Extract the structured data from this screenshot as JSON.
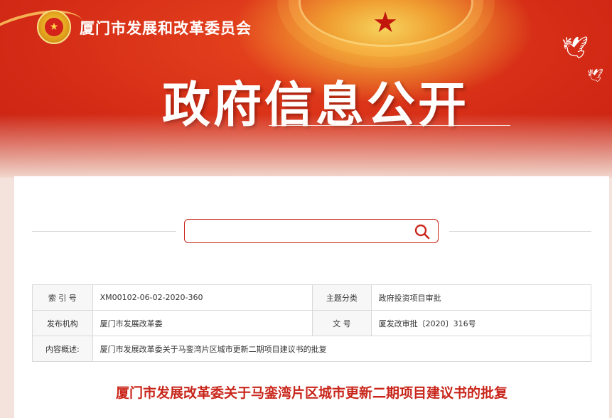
{
  "header": {
    "site_name": "厦门市发展和改革委员会",
    "banner_title": "政府信息公开",
    "emblem_icon": "national-emblem-icon"
  },
  "search": {
    "placeholder": "",
    "value": "",
    "icon": "search-icon"
  },
  "meta": {
    "rows": [
      {
        "label1": "索 引 号",
        "value1": "XM00102-06-02-2020-360",
        "label2": "主题分类",
        "value2": "政府投资项目审批"
      },
      {
        "label1": "发布机构",
        "value1": "厦门市发展改革委",
        "label2": "文  号",
        "value2": "厦发改审批〔2020〕316号"
      },
      {
        "label1": "内容概述:",
        "value1": "厦门市发展改革委关于马銮湾片区城市更新二期项目建议书的批复"
      }
    ]
  },
  "document": {
    "title": "厦门市发展改革委关于马銮湾片区城市更新二期项目建议书的批复"
  },
  "colors": {
    "brand_red": "#c9261b",
    "banner_red": "#d42b16",
    "gold": "#f6d25d"
  }
}
